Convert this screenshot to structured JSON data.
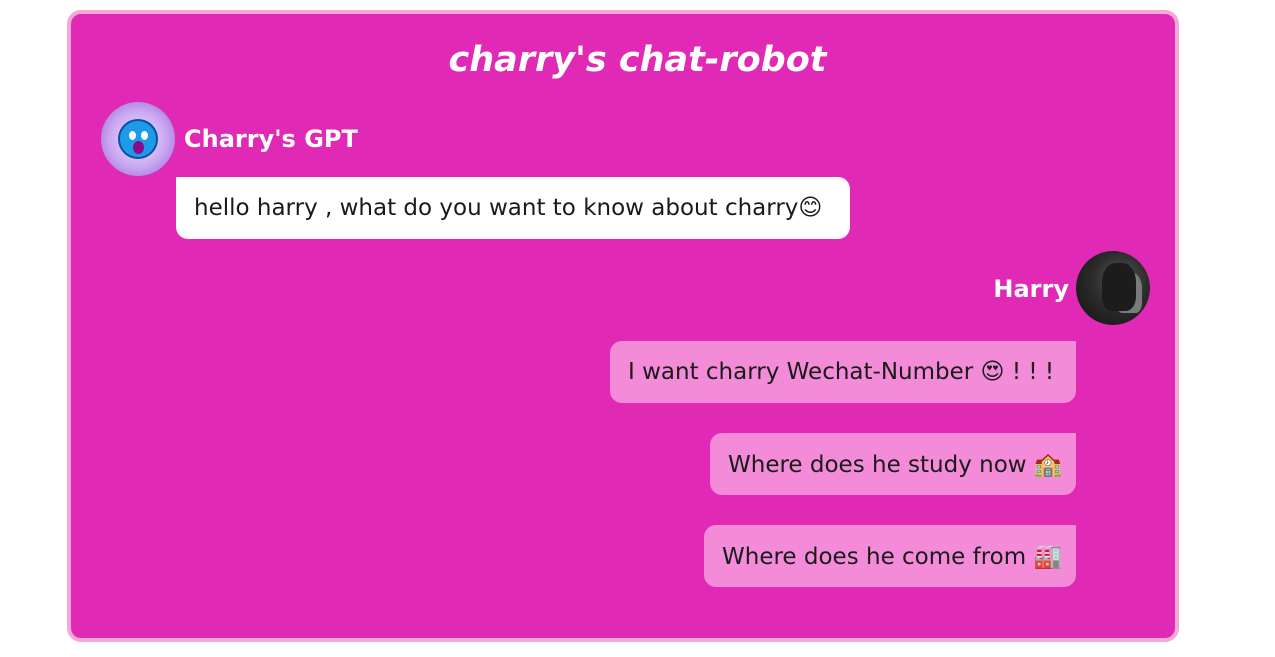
{
  "header": {
    "title": "charry's chat-robot"
  },
  "bot": {
    "name": "Charry's GPT",
    "avatar_icon": "blue-monster-avatar-icon"
  },
  "user": {
    "name": "Harry",
    "avatar_icon": "batman-avatar-icon"
  },
  "messages": [
    {
      "from": "bot",
      "text": "hello harry , what do you want to know about charry😊"
    },
    {
      "from": "user",
      "text": "I want charry Wechat-Number 😍 ! ! !"
    },
    {
      "from": "user",
      "text": "Where does he study now 🏫"
    },
    {
      "from": "user",
      "text": "Where does he come from 🏭"
    }
  ],
  "colors": {
    "panel_background": "#e02ab6",
    "panel_border": "#f4a9d8",
    "bot_bubble": "#ffffff",
    "user_bubble": "#f38bd8",
    "name_text": "#ffffff"
  }
}
